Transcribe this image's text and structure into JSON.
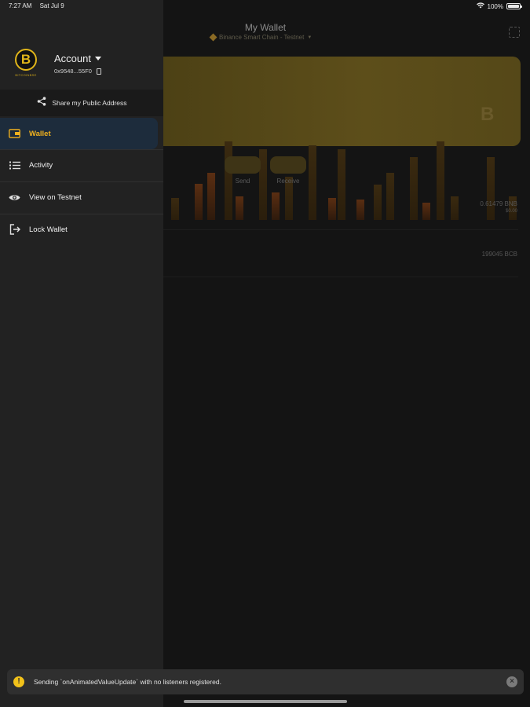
{
  "status_bar": {
    "time": "7:27 AM",
    "date": "Sat Jul 9",
    "battery": "100%"
  },
  "main": {
    "title": "My Wallet",
    "network": "Binance Smart Chain - Testnet",
    "send_label": "Send",
    "receive_label": "Receive",
    "bnb_balance": "0.61479 BNB",
    "bnb_fiat": "$0.00",
    "token_balance": "199045 BCB"
  },
  "drawer": {
    "logo_text": "BITCOINBSE",
    "account_name": "Account",
    "account_address": "0x9548...55F0",
    "share_label": "Share my Public Address",
    "items": [
      {
        "label": "Wallet",
        "icon": "wallet-icon"
      },
      {
        "label": "Activity",
        "icon": "list-icon"
      },
      {
        "label": "View on Testnet",
        "icon": "eye-icon"
      },
      {
        "label": "Lock Wallet",
        "icon": "logout-icon"
      }
    ]
  },
  "toast": {
    "icon_glyph": "!",
    "message": "Sending `onAnimatedValueUpdate` with no listeners registered.",
    "close_glyph": "×"
  },
  "colors": {
    "accent": "#f0b11e",
    "drawer_bg": "#222222",
    "active_bg": "#1d2c3c"
  }
}
